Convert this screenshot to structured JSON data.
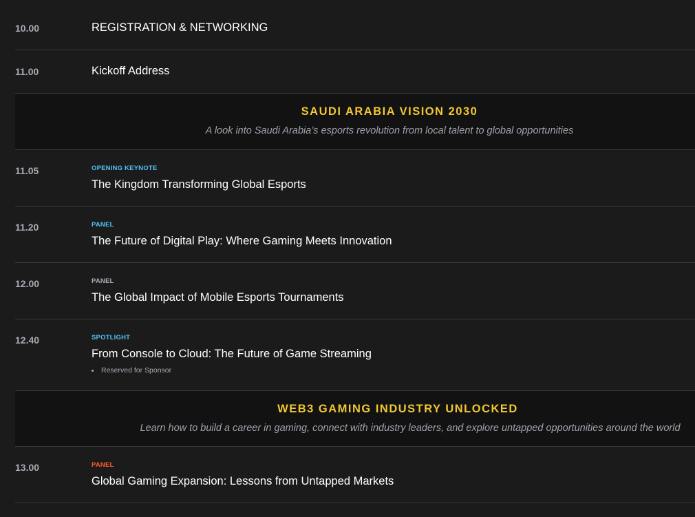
{
  "colors": {
    "tag_blue": "#4fc3f7",
    "tag_gray": "#a7abb2",
    "tag_orange": "#ff5a2c",
    "section_gold": "#f2c832",
    "time_gray": "#a7abb2"
  },
  "agenda": {
    "row_1": {
      "time": "10.00",
      "title": "REGISTRATION & NETWORKING"
    },
    "row_2": {
      "time": "11.00",
      "title": "Kickoff Address"
    },
    "section_1": {
      "title": "SAUDI ARABIA VISION 2030",
      "subtitle": "A look into Saudi Arabia’s esports revolution from local talent to global opportunities"
    },
    "row_3": {
      "time": "11.05",
      "tag": "OPENING KEYNOTE",
      "tag_color": "#4fc3f7",
      "title": "The Kingdom Transforming Global Esports"
    },
    "row_4": {
      "time": "11.20",
      "tag": "PANEL",
      "tag_color": "#4fc3f7",
      "title": "The Future of Digital Play: Where Gaming Meets Innovation"
    },
    "row_5": {
      "time": "12.00",
      "tag": "PANEL",
      "tag_color": "#a7abb2",
      "title": "The Global Impact of Mobile Esports Tournaments"
    },
    "row_6": {
      "time": "12.40",
      "tag": "SPOTLIGHT",
      "tag_color": "#4fc3f7",
      "title": "From Console to Cloud: The Future of Game Streaming",
      "bullet": "Reserved for Sponsor"
    },
    "section_2": {
      "title": "WEB3 GAMING INDUSTRY UNLOCKED",
      "subtitle": "Learn how to build a career in gaming, connect with industry leaders, and explore untapped opportunities around the world"
    },
    "row_7": {
      "time": "13.00",
      "tag": "PANEL",
      "tag_color": "#ff5a2c",
      "title": "Global Gaming Expansion: Lessons from Untapped Markets"
    }
  }
}
